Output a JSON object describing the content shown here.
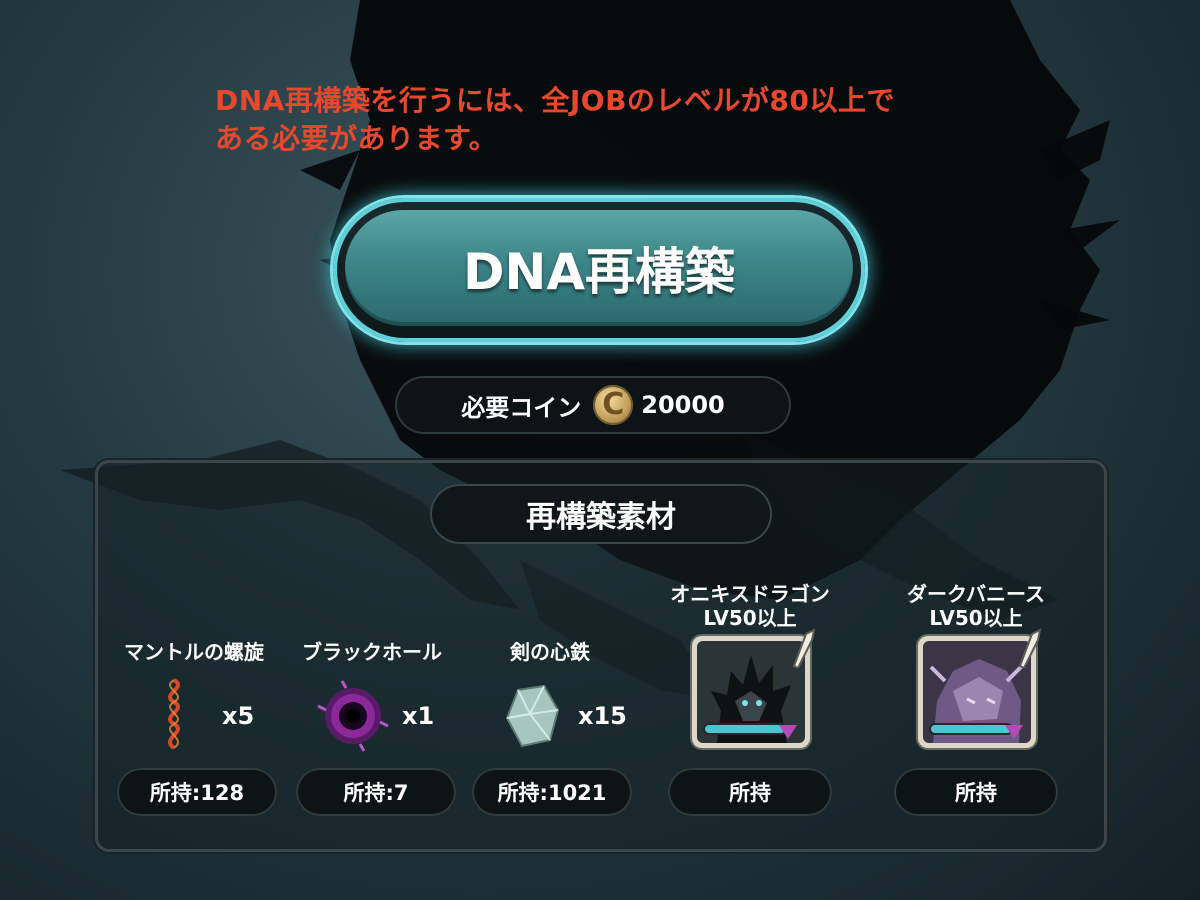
{
  "warning": {
    "line1": "DNA再構築を行うには、全JOBのレベルが80以上で",
    "line2": "ある必要があります。"
  },
  "rebuild_button": {
    "label": "DNA再構築"
  },
  "cost": {
    "label": "必要コイン",
    "coin_symbol": "C",
    "amount": "20000"
  },
  "materials_panel": {
    "title": "再構築素材"
  },
  "materials": [
    {
      "name": "マントルの螺旋",
      "icon": "spiral-dna-icon",
      "qty": "x5",
      "owned": "所持:128"
    },
    {
      "name": "ブラックホール",
      "icon": "black-hole-icon",
      "qty": "x1",
      "owned": "所持:7"
    },
    {
      "name": "剣の心鉄",
      "icon": "crystal-ore-icon",
      "qty": "x15",
      "owned": "所持:1021"
    }
  ],
  "monsters": [
    {
      "name": "オニキスドラゴン",
      "req": "LV50以上",
      "icon": "onyx-dragon-portrait",
      "owned": "所持"
    },
    {
      "name": "ダークバニース",
      "req": "LV50以上",
      "icon": "dark-banies-portrait",
      "owned": "所持"
    }
  ],
  "colors": {
    "warning": "#e8482e",
    "button_glow": "#7fe3ea",
    "button_fill": "#3d8588",
    "monster_bar": "#4fc3cf",
    "monster_gem": "#b14bb7"
  }
}
